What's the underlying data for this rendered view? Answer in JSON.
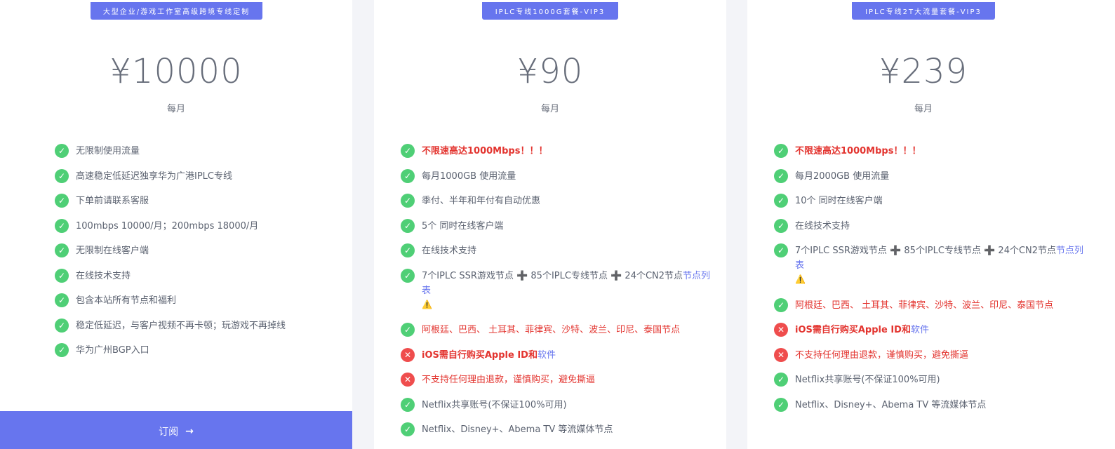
{
  "plans": [
    {
      "badge": "大型企业/游戏工作室高级跨境专线定制",
      "price": "¥10000",
      "period": "每月",
      "features": [
        "无限制使用流量",
        "高速稳定低延迟独享华为广港IPLC专线",
        "下单前请联系客服",
        "100mbps 10000/月；200mbps 18000/月",
        "无限制在线客户端",
        "在线技术支持",
        "包含本站所有节点和福利",
        "稳定低延迟，与客户视频不再卡顿；玩游戏不再掉线",
        "华为广州BGP入口"
      ],
      "subscribe_label": "订阅",
      "subscribe_arrow": "→"
    },
    {
      "badge": "IPLC专线1000G套餐-VIP3",
      "price": "¥90",
      "period": "每月",
      "features": [
        "不限速高达1000Mbps！！！",
        "每月1000GB 使用流量",
        "季付、半年和年付有自动优惠",
        "5个 同时在线客户端",
        "在线技术支持",
        "7个IPLC SSR游戏节点",
        "85个IPLC专线节点",
        "24个CN2节点",
        "节点列表",
        "阿根廷、巴西、 土耳其、菲律宾、沙特、波兰、印尼、泰国节点",
        "iOS需自行购买Apple ID和",
        "软件",
        "不支持任何理由退款，谨慎购买，避免撕逼",
        "Netflix共享账号(不保证100%可用)",
        "Netflix、Disney+、Abema TV 等流媒体节点"
      ]
    },
    {
      "badge": "IPLC专线2T大流量套餐-VIP3",
      "price": "¥239",
      "period": "每月",
      "features": [
        "不限速高达1000Mbps！！！",
        "每月2000GB 使用流量",
        "10个 同时在线客户端",
        "在线技术支持",
        "7个IPLC SSR游戏节点",
        "85个IPLC专线节点",
        "24个CN2节点",
        "节点列表",
        "阿根廷、巴西、 土耳其、菲律宾、沙特、波兰、印尼、泰国节点",
        "iOS需自行购买Apple ID和",
        "软件",
        "不支持任何理由退款，谨慎购买，避免撕逼",
        "Netflix共享账号(不保证100%可用)",
        "Netflix、Disney+、Abema TV 等流媒体节点"
      ]
    }
  ],
  "icons": {
    "check": "✓",
    "cross": "✕",
    "plus": "➕",
    "warning": "⚠️"
  },
  "colors": {
    "accent": "#6775ee",
    "check": "#4fcf76",
    "cross": "#ef4d4d",
    "alert_text": "#e3342f"
  }
}
